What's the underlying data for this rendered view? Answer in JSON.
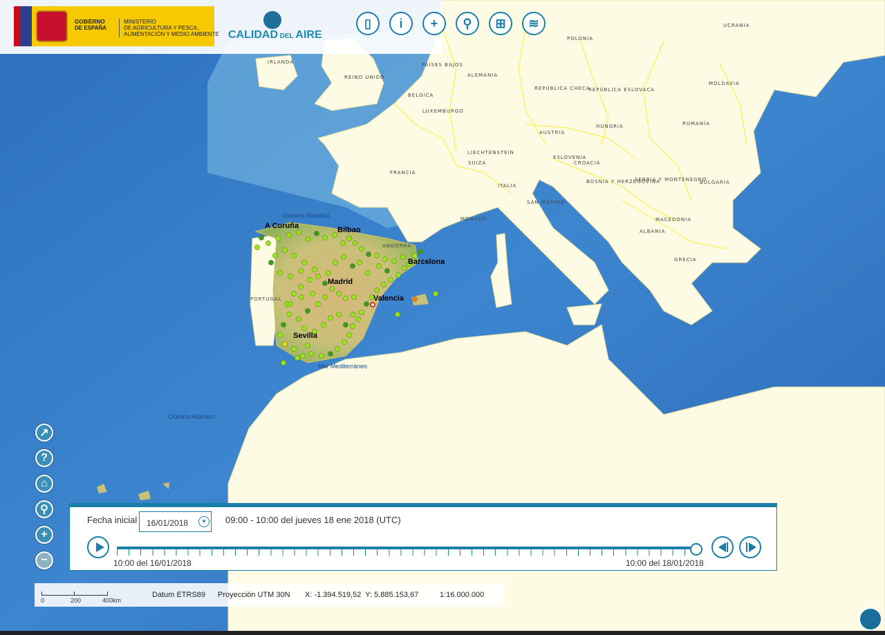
{
  "header": {
    "gobierno": "GOBIERNO\nDE ESPAÑA",
    "ministerio": "MINISTERIO\nDE AGRICULTURA Y PESCA,\nALIMENTACIÓN Y MEDIO AMBIENTE",
    "calidad_1": "CALIDAD",
    "calidad_2": " DEL ",
    "calidad_3": "AIRE"
  },
  "toolbar": {
    "icons": [
      "ruler-icon",
      "info-icon",
      "bookmark-icon",
      "map-pin-icon",
      "hierarchy-icon",
      "layers-icon"
    ]
  },
  "side_tools": {
    "icons": [
      "share-icon",
      "help-icon",
      "home-icon",
      "zoom-search-icon",
      "zoom-in-icon",
      "zoom-out-icon"
    ]
  },
  "map": {
    "countries": [
      "IRLANDA",
      "REINO UNIDO",
      "PAÍSES BAJOS",
      "BÉLGICA",
      "LUXEMBURGO",
      "ALEMANIA",
      "POLONIA",
      "UCRANIA",
      "MOLDAVIA",
      "REPÚBLICA CHECA",
      "REPÚBLICA ESLOVACA",
      "AUSTRIA",
      "HUNGRÍA",
      "RUMANÍA",
      "FRANCIA",
      "LIECHTENSTEIN",
      "SUIZA",
      "ESLOVENIA",
      "CROACIA",
      "ITALIA",
      "BOSNIA Y HERZEGOVINA",
      "SERBIA Y MONTENEGRO",
      "BULGARIA",
      "SAN MARINO",
      "MÓNACO",
      "MACEDONIA",
      "ALBANIA",
      "GRECIA",
      "ANDORRA",
      "PORTUGAL"
    ],
    "cities": [
      "A Coruña",
      "Bilbao",
      "Barcelona",
      "Madrid",
      "Valencia",
      "Sevilla"
    ],
    "seas": [
      "Océano Atlántico",
      "Mar Mediterráneo",
      "Océano Atlántico"
    ],
    "station_colors": {
      "good": "#9be21c",
      "very_good": "#3a9a1e",
      "moderate": "#f0d020",
      "poor": "#f08020"
    }
  },
  "time_panel": {
    "label": "Fecha inicial",
    "date_value": "16/01/2018",
    "range_text": "09:00 - 10:00 del jueves 18 ene 2018 (UTC)",
    "start_label": "10:00 del 16/01/2018",
    "end_label": "10:00 del 18/01/2018",
    "progress": 1.0
  },
  "info_bar": {
    "scale_0": "0",
    "scale_200": "200",
    "scale_400": "400km",
    "datum": "Datum ETRS89",
    "projection": "Proyección UTM 30N",
    "coords": "X: -1.394.519,52  Y: 5.885.153,67",
    "scale": "1:16.000.000"
  }
}
